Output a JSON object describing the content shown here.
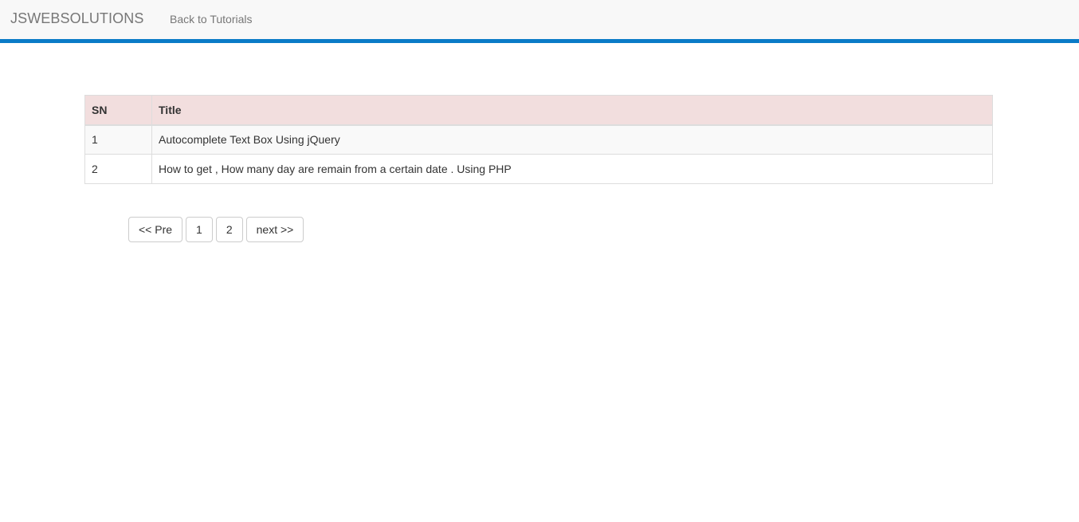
{
  "navbar": {
    "brand": "JSWEBSOLUTIONS",
    "back_link": "Back to Tutorials",
    "accent_color": "#0a7bc7"
  },
  "table": {
    "headers": [
      "SN",
      "Title"
    ],
    "header_bg": "#f2dede",
    "rows": [
      {
        "sn": "1",
        "title": "Autocomplete Text Box Using jQuery"
      },
      {
        "sn": "2",
        "title": "How to get , How many day are remain from a certain date . Using PHP"
      }
    ]
  },
  "pagination": {
    "prev_label": "<< Pre",
    "pages": [
      "1",
      "2"
    ],
    "next_label": "next >>"
  }
}
